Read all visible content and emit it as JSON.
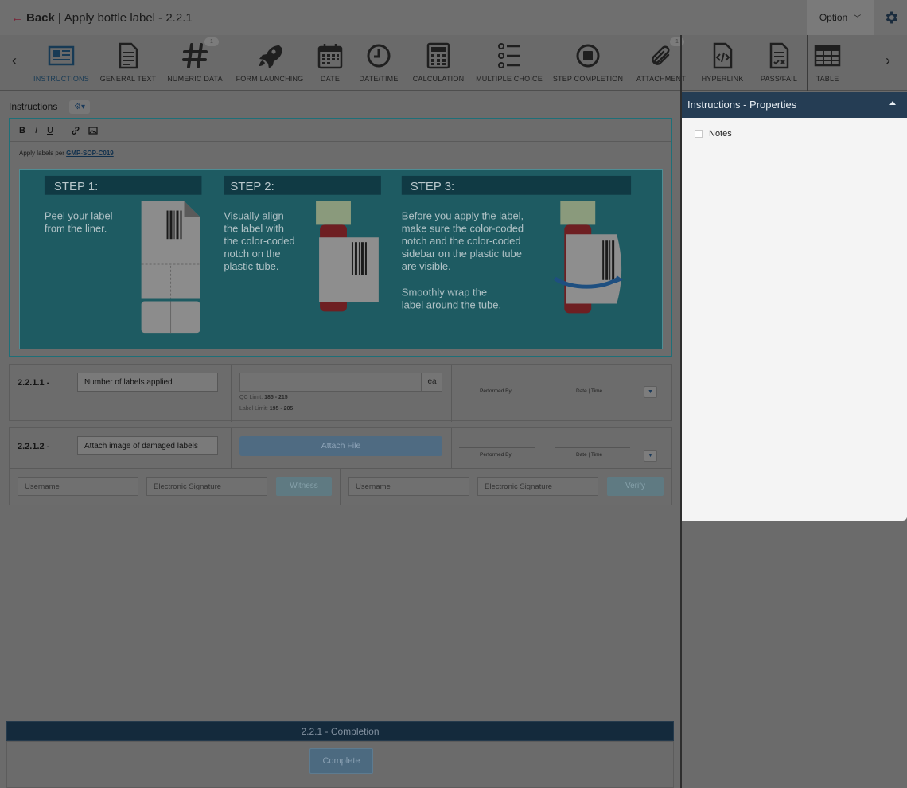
{
  "header": {
    "back_label": "Back",
    "separator": "|",
    "title": "Apply bottle label - 2.2.1",
    "option_label": "Option",
    "accent_color": "#7a1e34"
  },
  "toolbar": {
    "items": [
      {
        "label": "INSTRUCTIONS",
        "icon": "newspaper-icon",
        "active": true
      },
      {
        "label": "GENERAL TEXT",
        "icon": "document-icon"
      },
      {
        "label": "NUMERIC DATA",
        "icon": "hash-icon",
        "badge": "1"
      },
      {
        "label": "FORM LAUNCHING",
        "icon": "rocket-icon"
      },
      {
        "label": "DATE",
        "icon": "calendar-icon"
      },
      {
        "label": "DATE/TIME",
        "icon": "clock-icon"
      },
      {
        "label": "CALCULATION",
        "icon": "calculator-icon"
      },
      {
        "label": "MULTIPLE CHOICE",
        "icon": "list-icon"
      },
      {
        "label": "STEP COMPLETION",
        "icon": "stop-circle-icon"
      },
      {
        "label": "ATTACHMENT",
        "icon": "paperclip-icon",
        "badge": "1"
      },
      {
        "label": "HYPERLINK",
        "icon": "code-file-icon"
      },
      {
        "label": "PASS/FAIL",
        "icon": "checklist-file-icon"
      },
      {
        "label": "TABLE",
        "icon": "table-icon"
      }
    ]
  },
  "instructions": {
    "section_title": "Instructions",
    "format_buttons": [
      "B",
      "I",
      "U"
    ],
    "text_prefix": "Apply labels per ",
    "link_text": "GMP-SOP-C019",
    "steps": [
      {
        "heading": "STEP 1:",
        "lines": [
          "Peel your label",
          "from the liner."
        ]
      },
      {
        "heading": "STEP 2:",
        "lines": [
          "Visually align",
          "the label with",
          "the color-coded",
          "notch on the",
          "plastic tube."
        ]
      },
      {
        "heading": "STEP 3:",
        "lines": [
          "Before you apply the label,",
          "make sure the color-coded",
          "notch and the color-coded",
          "sidebar on the plastic tube",
          "are visible.",
          "",
          "Smoothly wrap the",
          "label around the tube."
        ]
      }
    ],
    "teal_color": "#1e5b62"
  },
  "rows": [
    {
      "id": "2.2.1.1  -",
      "name": "Number of labels applied",
      "unit": "ea",
      "qc_limit_label": "QC Limit: ",
      "qc_limit_value": "185 - 215",
      "label_limit_label": "Label Limit: ",
      "label_limit_value": "195 - 205",
      "performed_by": "Performed By",
      "date_time": "Date | Time"
    },
    {
      "id": "2.2.1.2  -",
      "name": "Attach image of damaged labels",
      "attach_label": "Attach File",
      "performed_by": "Performed By",
      "date_time": "Date | Time",
      "username_placeholder": "Username",
      "signature_placeholder": "Electronic Signature",
      "witness_label": "Witness",
      "verify_label": "Verify"
    }
  ],
  "completion": {
    "title": "2.2.1 - Completion",
    "button": "Complete"
  },
  "properties": {
    "title": "Instructions - Properties",
    "notes_label": "Notes"
  }
}
